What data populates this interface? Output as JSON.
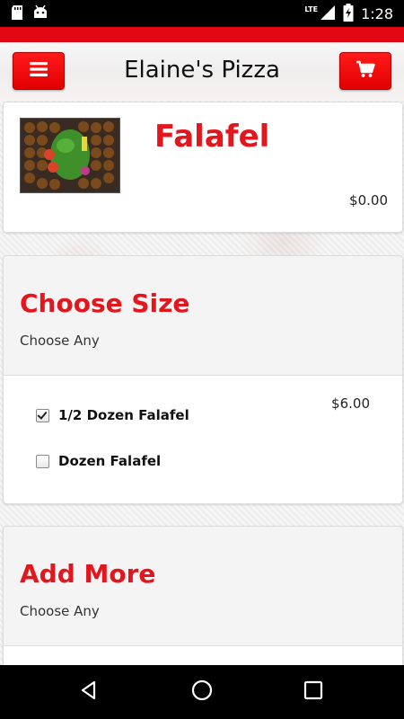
{
  "status_bar": {
    "time": "1:28",
    "network": "LTE",
    "icons": [
      "sd-card-icon",
      "android-icon",
      "signal-icon",
      "battery-charging-icon"
    ]
  },
  "header": {
    "title": "Elaine's Pizza",
    "menu_icon": "hamburger-menu-icon",
    "cart_icon": "shopping-cart-icon"
  },
  "item": {
    "name": "Falafel",
    "price": "$0.00",
    "image": "falafel-photo"
  },
  "sections": [
    {
      "title": "Choose Size",
      "subtitle": "Choose Any",
      "options": [
        {
          "label": "1/2 Dozen Falafel",
          "checked": true,
          "price": "$6.00"
        },
        {
          "label": "Dozen Falafel",
          "checked": false
        }
      ]
    },
    {
      "title": "Add More",
      "subtitle": "Choose Any"
    }
  ],
  "nav_bar": {
    "icons": [
      "back-icon",
      "home-icon",
      "recent-apps-icon"
    ]
  },
  "colors": {
    "accent": "#e30613",
    "title_red": "#e3151d",
    "status_bar": "#000000"
  }
}
